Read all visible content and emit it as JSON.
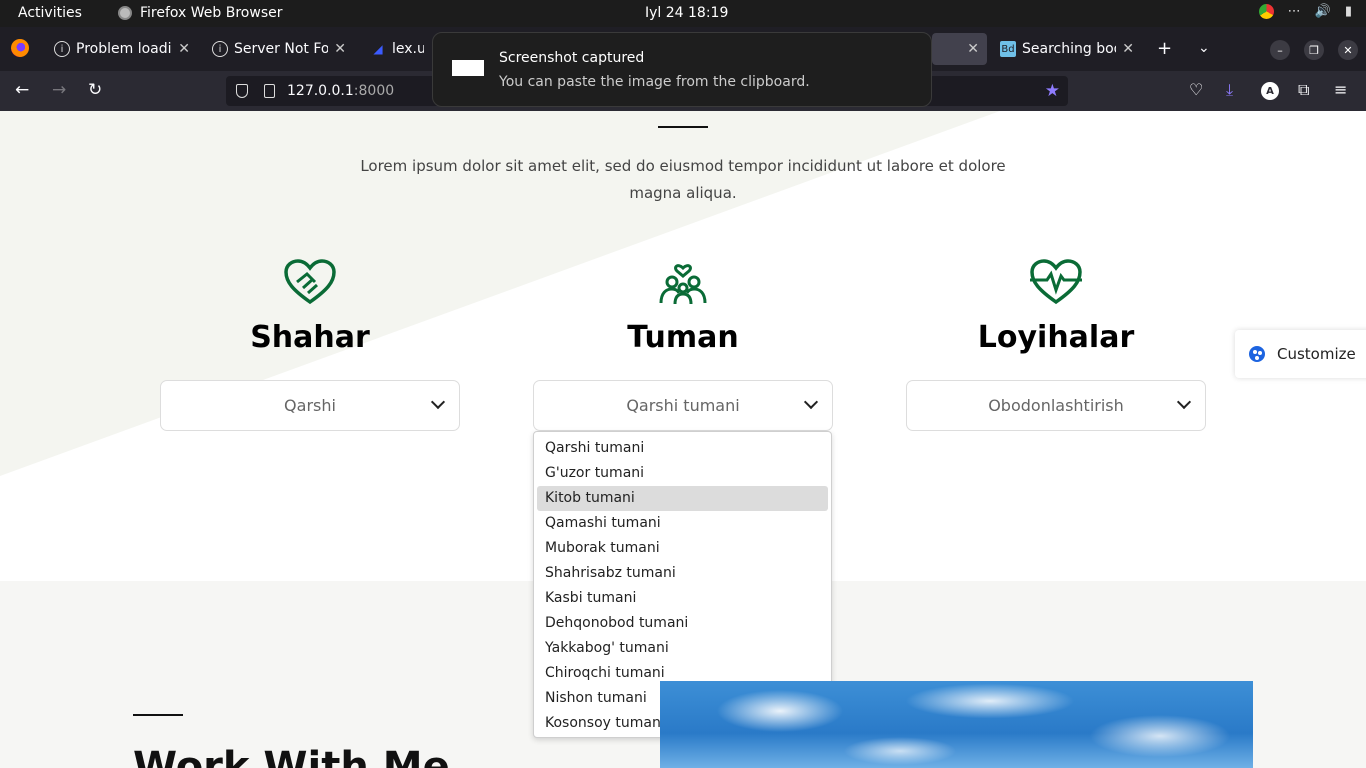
{
  "topbar": {
    "activities": "Activities",
    "app_name": "Firefox Web Browser",
    "clock": "Iyl 24  18:19"
  },
  "tabs": [
    {
      "title": "Problem loading",
      "icon": "info-icon"
    },
    {
      "title": "Server Not Found",
      "icon": "info-icon"
    },
    {
      "title": "lex.uz/",
      "icon": "lex-favicon"
    },
    {
      "title": "Searching boot",
      "icon": "bd-favicon"
    }
  ],
  "toolbar": {
    "url_host": "127.0.0.1",
    "url_port": ":8000"
  },
  "toast": {
    "title": "Screenshot captured",
    "message": "You can paste the image from the clipboard."
  },
  "page": {
    "lead": "Lorem ipsum dolor sit amet elit, sed do eiusmod tempor incididunt ut labore et dolore magna aliqua.",
    "columns": [
      {
        "title": "Shahar",
        "selected": "Qarshi",
        "icon": "handshake-heart-icon"
      },
      {
        "title": "Tuman",
        "selected": "Qarshi tumani",
        "icon": "people-heart-icon"
      },
      {
        "title": "Loyihalar",
        "selected": "Obodonlashtirish",
        "icon": "heartbeat-icon"
      }
    ],
    "dropdown_options": [
      "Qarshi tumani",
      "G'uzor tumani",
      "Kitob tumani",
      "Qamashi tumani",
      "Muborak tumani",
      "Shahrisabz tumani",
      "Kasbi tumani",
      "Dehqonobod tumani",
      "Yakkabog' tumani",
      "Chiroqchi tumani",
      "Nishon tumani",
      "Kosonsoy tumani"
    ],
    "highlighted_option": "Kitob tumani",
    "customize": "Customize",
    "work_title": "Work With Me"
  },
  "colors": {
    "accent_green": "#0a6b36",
    "bg_tint": "#f6f6f4"
  }
}
